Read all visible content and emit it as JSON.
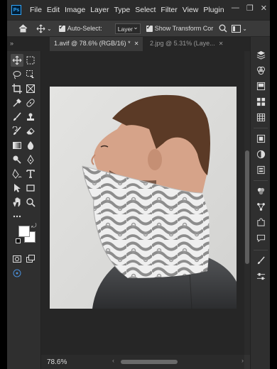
{
  "app": {
    "logo_text": "Ps"
  },
  "menu": [
    "File",
    "Edit",
    "Image",
    "Layer",
    "Type",
    "Select",
    "Filter",
    "View",
    "Plugin"
  ],
  "window_controls": {
    "minimize": "—",
    "maximize": "❐",
    "close": "✕"
  },
  "options": {
    "auto_select_label": "Auto-Select:",
    "layer_select_value": "Layer",
    "show_transform_label": "Show Transform Cor"
  },
  "tabs": [
    {
      "label": "1.avif @ 78.6% (RGB/16) *",
      "close": "✕"
    },
    {
      "label": "2.jpg @ 5.31% (Laye...",
      "close": "✕"
    }
  ],
  "panel_collapse": "»",
  "status": {
    "zoom": "78.6%"
  },
  "colors": {
    "foreground": "#ffffff",
    "background": "#ffffff",
    "accent": "#31a8ff"
  }
}
